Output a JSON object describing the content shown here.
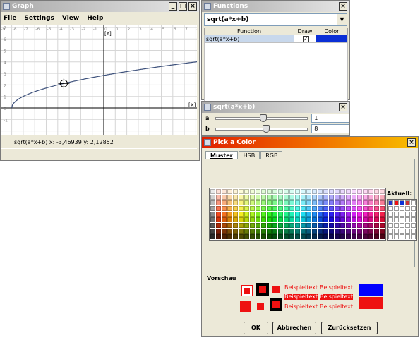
{
  "graph_window": {
    "title": "Graph",
    "menu": [
      "File",
      "Settings",
      "View",
      "Help"
    ],
    "status_text": "sqrt(a*x+b)   x: -3,46939 y: 2,12852",
    "axis_label_y": "[Y]",
    "axis_label_x": "[X]",
    "x_ticks": [
      "-9",
      "-8",
      "-7",
      "-6",
      "-5",
      "-4",
      "-3",
      "-2",
      "-1",
      "0",
      "1",
      "2",
      "3",
      "4",
      "5",
      "6",
      "7",
      "8"
    ],
    "y_ticks": [
      "7",
      "6",
      "5",
      "4",
      "3",
      "2",
      "1",
      "0",
      "-1"
    ],
    "curve_color": "#3b4f7a"
  },
  "functions_window": {
    "title": "Functions",
    "combo_value": "sqrt(a*x+b)",
    "col_function": "Function",
    "col_draw": "Draw",
    "col_color": "Color",
    "row_function": "sqrt(a*x+b)",
    "row_draw_checked": true,
    "row_color": "#0a2fd6"
  },
  "params_window": {
    "title": "sqrt(a*x+b)",
    "a_label": "a",
    "a_value": "1",
    "a_level": 0.47,
    "b_label": "b",
    "b_value": "8",
    "b_level": 0.5
  },
  "color_window": {
    "title": "Pick a Color",
    "tabs": [
      "Muster",
      "HSB",
      "RGB"
    ],
    "active_tab": "Muster",
    "recent_label": "Aktuell:",
    "preview_label": "Vorschau",
    "sample_text": "Beispieltext",
    "ok_label": "OK",
    "cancel_label": "Abbrechen",
    "reset_label": "Zurücksetzen",
    "preview_color": "#ee1111",
    "blue_color": "#0000ff"
  },
  "icons": [
    "window-icon",
    "minimize-icon",
    "maximize-icon",
    "close-icon",
    "chevron-down-icon",
    "crosshair-icon"
  ]
}
